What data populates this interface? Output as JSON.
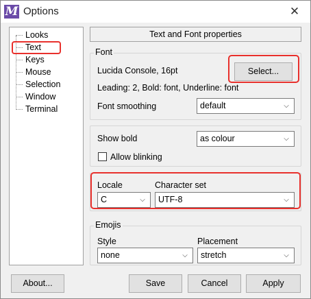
{
  "window": {
    "title": "Options",
    "app_icon_glyph": "M",
    "close_glyph": "✕"
  },
  "tree": {
    "items": [
      {
        "label": "Looks",
        "selected": false
      },
      {
        "label": "Text",
        "selected": true
      },
      {
        "label": "Keys",
        "selected": false
      },
      {
        "label": "Mouse",
        "selected": false
      },
      {
        "label": "Selection",
        "selected": false
      },
      {
        "label": "Window",
        "selected": false
      },
      {
        "label": "Terminal",
        "selected": false
      }
    ]
  },
  "panel": {
    "header": "Text and Font properties"
  },
  "font_group": {
    "label": "Font",
    "font_desc": "Lucida Console, 16pt",
    "select_button": "Select...",
    "details": "Leading: 2, Bold: font, Underline: font",
    "smoothing_label": "Font smoothing",
    "smoothing_value": "default"
  },
  "bold_group": {
    "show_bold_label": "Show bold",
    "show_bold_value": "as colour",
    "allow_blinking_label": "Allow blinking",
    "allow_blinking_checked": false
  },
  "locale_group": {
    "locale_label": "Locale",
    "locale_value": "C",
    "charset_label": "Character set",
    "charset_value": "UTF-8"
  },
  "emojis_group": {
    "label": "Emojis",
    "style_label": "Style",
    "style_value": "none",
    "placement_label": "Placement",
    "placement_value": "stretch"
  },
  "buttons": {
    "about": "About...",
    "save": "Save",
    "cancel": "Cancel",
    "apply": "Apply"
  },
  "colors": {
    "highlight_red": "#e8302c",
    "app_icon_purple": "#6a4aa8"
  }
}
